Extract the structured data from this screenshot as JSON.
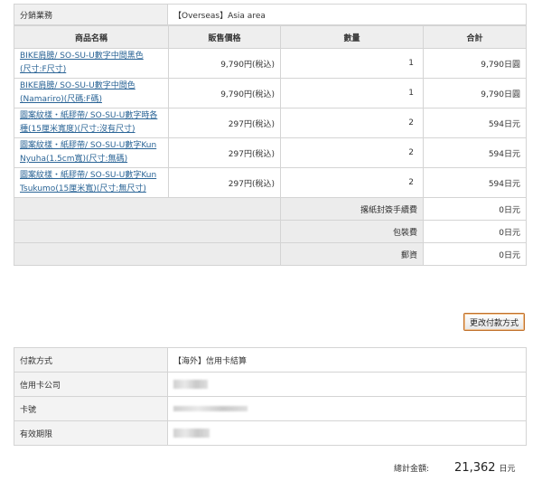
{
  "sales_area": {
    "label": "分銷業務",
    "value": "【Overseas】Asia area"
  },
  "order_table": {
    "headers": [
      "商品名稱",
      "販售價格",
      "數量",
      "合計"
    ],
    "rows": [
      {
        "name_line1": "BIKE肩膀/ SO-SU-U數字中間黑色",
        "name_line2": "(尺寸:F尺寸)",
        "price": "9,790円(稅込)",
        "qty": "1",
        "total": "9,790日圓"
      },
      {
        "name_line1": "BIKE肩膀/ SO-SU-U數字中間色",
        "name_line2": "(Namariro)(尺碼:F碼)",
        "price": "9,790円(稅込)",
        "qty": "1",
        "total": "9,790日圓"
      },
      {
        "name_line1": "圖案紋樣・紙膠帶/ SO-SU-U數字時各",
        "name_line2": "種(15厘米寬度)(尺寸:沒有尺寸)",
        "price": "297円(稅込)",
        "qty": "2",
        "total": "594日元"
      },
      {
        "name_line1": "圖案紋樣・紙膠帶/ SO-SU-U數字Kun",
        "name_line2": "Nyuha(1.5cm寬)(尺寸:無碼)",
        "price": "297円(稅込)",
        "qty": "2",
        "total": "594日元"
      },
      {
        "name_line1": "圖案紋樣・紙膠帶/ SO-SU-U數字Kun",
        "name_line2": "Tsukumo(15厘米寬)(尺寸:無尺寸)",
        "price": "297円(稅込)",
        "qty": "2",
        "total": "594日元"
      }
    ],
    "fees": [
      {
        "label": "撂紙封簽手續費",
        "value": "0日元"
      },
      {
        "label": "包裝費",
        "value": "0日元"
      },
      {
        "label": "郵資",
        "value": "0日元"
      }
    ]
  },
  "change_payment_button": "更改付款方式",
  "payment_table": {
    "rows": [
      {
        "label": "付款方式",
        "value": "【海外】信用卡結算",
        "blurred": false
      },
      {
        "label": "信用卡公司",
        "value": "",
        "blurred": true
      },
      {
        "label": "卡號",
        "value": "",
        "blurred": true
      },
      {
        "label": "有效期限",
        "value": "",
        "blurred": true
      }
    ]
  },
  "grand_total": {
    "label": "總計金額:",
    "value": "21,362",
    "unit": "日元"
  }
}
